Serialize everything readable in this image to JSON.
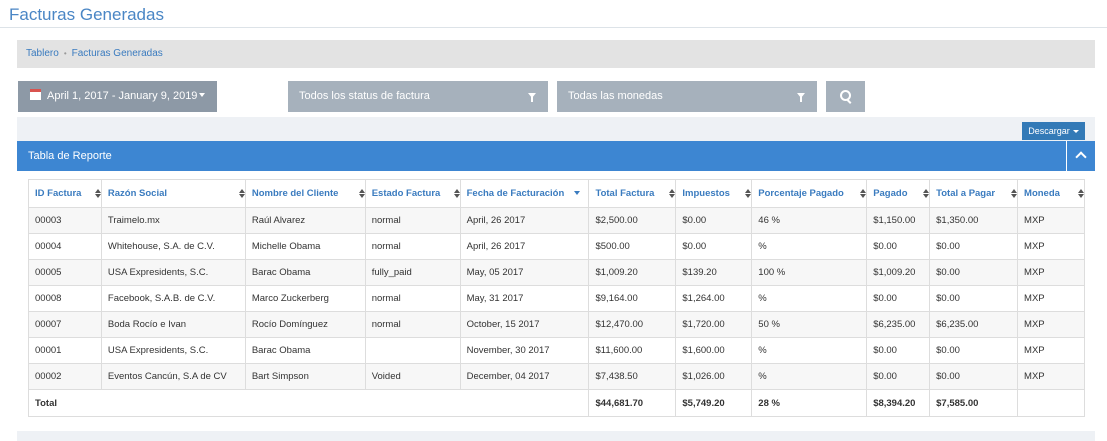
{
  "page": {
    "title": "Facturas Generadas"
  },
  "breadcrumb": {
    "items": [
      "Tablero",
      "Facturas Generadas"
    ]
  },
  "filters": {
    "date_range": "April 1, 2017 - January 9, 2019",
    "status": "Todos los status de factura",
    "currency": "Todas las monedas"
  },
  "download": {
    "label": "Descargar"
  },
  "panel": {
    "title": "Tabla de Reporte"
  },
  "table": {
    "columns": [
      "ID Factura",
      "Razón Social",
      "Nombre del Cliente",
      "Estado Factura",
      "Fecha de Facturación",
      "Total Factura",
      "Impuestos",
      "Porcentaje Pagado",
      "Pagado",
      "Total a Pagar",
      "Moneda"
    ],
    "rows": [
      [
        "00003",
        "Traimelo.mx",
        "Raúl Alvarez",
        "normal",
        "April, 26 2017",
        "$2,500.00",
        "$0.00",
        "46 %",
        "$1,150.00",
        "$1,350.00",
        "MXP"
      ],
      [
        "00004",
        "Whitehouse, S.A. de C.V.",
        "Michelle Obama",
        "normal",
        "April, 26 2017",
        "$500.00",
        "$0.00",
        "%",
        "$0.00",
        "$0.00",
        "MXP"
      ],
      [
        "00005",
        "USA Expresidents, S.C.",
        "Barac Obama",
        "fully_paid",
        "May, 05 2017",
        "$1,009.20",
        "$139.20",
        "100 %",
        "$1,009.20",
        "$0.00",
        "MXP"
      ],
      [
        "00008",
        "Facebook, S.A.B. de C.V.",
        "Marco Zuckerberg",
        "normal",
        "May, 31 2017",
        "$9,164.00",
        "$1,264.00",
        "%",
        "$0.00",
        "$0.00",
        "MXP"
      ],
      [
        "00007",
        "Boda Rocío e Ivan",
        "Rocío Domínguez",
        "normal",
        "October, 15 2017",
        "$12,470.00",
        "$1,720.00",
        "50 %",
        "$6,235.00",
        "$6,235.00",
        "MXP"
      ],
      [
        "00001",
        "USA Expresidents, S.C.",
        "Barac Obama",
        "",
        "November, 30 2017",
        "$11,600.00",
        "$1,600.00",
        "%",
        "$0.00",
        "$0.00",
        "MXP"
      ],
      [
        "00002",
        "Eventos Cancún, S.A de CV",
        "Bart Simpson",
        "Voided",
        "December, 04 2017",
        "$7,438.50",
        "$1,026.00",
        "%",
        "$0.00",
        "$0.00",
        "MXP"
      ]
    ],
    "totals": {
      "label": "Total",
      "total_factura": "$44,681.70",
      "impuestos": "$5,749.20",
      "porcentaje": "28 %",
      "pagado": "$8,394.20",
      "total_a_pagar": "$7,585.00"
    }
  },
  "colors": {
    "accent": "#3d86d2",
    "filter_bg": "#a6b1bc",
    "link": "#3a7bbf"
  }
}
